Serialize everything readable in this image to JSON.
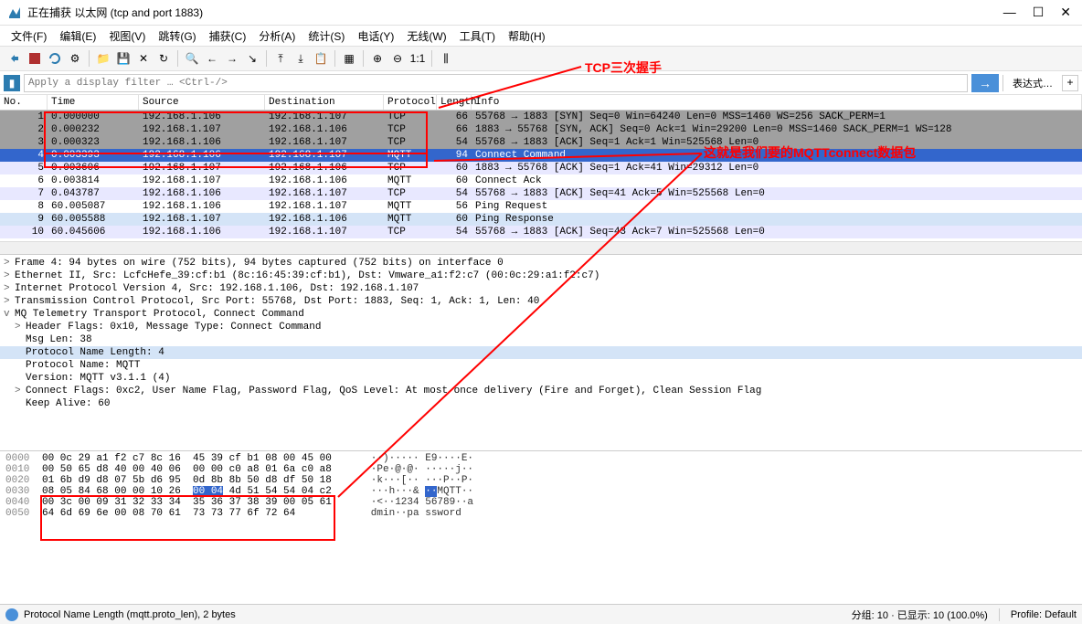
{
  "title": "正在捕获 以太网 (tcp and port 1883)",
  "menu": [
    "文件(F)",
    "编辑(E)",
    "视图(V)",
    "跳转(G)",
    "捕获(C)",
    "分析(A)",
    "统计(S)",
    "电话(Y)",
    "无线(W)",
    "工具(T)",
    "帮助(H)"
  ],
  "filter": {
    "placeholder": "Apply a display filter … <Ctrl-/>",
    "expression": "表达式…"
  },
  "columns": {
    "no": "No.",
    "time": "Time",
    "src": "Source",
    "dst": "Destination",
    "proto": "Protocol",
    "len": "Length",
    "info": "Info"
  },
  "annotations": {
    "tcp_handshake": "TCP三次握手",
    "mqtt_connect": "这就是我们要的MQTTconnect数据包"
  },
  "packets": [
    {
      "no": "1",
      "time": "0.000000",
      "src": "192.168.1.106",
      "dst": "192.168.1.107",
      "proto": "TCP",
      "len": "66",
      "info": "55768 → 1883 [SYN] Seq=0 Win=64240 Len=0 MSS=1460 WS=256 SACK_PERM=1",
      "cls": "grey"
    },
    {
      "no": "2",
      "time": "0.000232",
      "src": "192.168.1.107",
      "dst": "192.168.1.106",
      "proto": "TCP",
      "len": "66",
      "info": "1883 → 55768 [SYN, ACK] Seq=0 Ack=1 Win=29200 Len=0 MSS=1460 SACK_PERM=1 WS=128",
      "cls": "grey"
    },
    {
      "no": "3",
      "time": "0.000323",
      "src": "192.168.1.106",
      "dst": "192.168.1.107",
      "proto": "TCP",
      "len": "54",
      "info": "55768 → 1883 [ACK] Seq=1 Ack=1 Win=525568 Len=0",
      "cls": "grey"
    },
    {
      "no": "4",
      "time": "0.003393",
      "src": "192.168.1.106",
      "dst": "192.168.1.107",
      "proto": "MQTT",
      "len": "94",
      "info": "Connect Command",
      "cls": "blue-sel"
    },
    {
      "no": "5",
      "time": "0.003606",
      "src": "192.168.1.107",
      "dst": "192.168.1.106",
      "proto": "TCP",
      "len": "60",
      "info": "1883 → 55768 [ACK] Seq=1 Ack=41 Win=29312 Len=0",
      "cls": "lightblue"
    },
    {
      "no": "6",
      "time": "0.003814",
      "src": "192.168.1.107",
      "dst": "192.168.1.106",
      "proto": "MQTT",
      "len": "60",
      "info": "Connect Ack",
      "cls": "white"
    },
    {
      "no": "7",
      "time": "0.043787",
      "src": "192.168.1.106",
      "dst": "192.168.1.107",
      "proto": "TCP",
      "len": "54",
      "info": "55768 → 1883 [ACK] Seq=41 Ack=5 Win=525568 Len=0",
      "cls": "lightblue"
    },
    {
      "no": "8",
      "time": "60.005087",
      "src": "192.168.1.106",
      "dst": "192.168.1.107",
      "proto": "MQTT",
      "len": "56",
      "info": "Ping Request",
      "cls": "white"
    },
    {
      "no": "9",
      "time": "60.005588",
      "src": "192.168.1.107",
      "dst": "192.168.1.106",
      "proto": "MQTT",
      "len": "60",
      "info": "Ping Response",
      "cls": "light2"
    },
    {
      "no": "10",
      "time": "60.045606",
      "src": "192.168.1.106",
      "dst": "192.168.1.107",
      "proto": "TCP",
      "len": "54",
      "info": "55768 → 1883 [ACK] Seq=43 Ack=7 Win=525568 Len=0",
      "cls": "lightblue"
    }
  ],
  "tree": [
    {
      "caret": ">",
      "text": "Frame 4: 94 bytes on wire (752 bits), 94 bytes captured (752 bits) on interface 0",
      "indent": 0
    },
    {
      "caret": ">",
      "text": "Ethernet II, Src: LcfcHefe_39:cf:b1 (8c:16:45:39:cf:b1), Dst: Vmware_a1:f2:c7 (00:0c:29:a1:f2:c7)",
      "indent": 0
    },
    {
      "caret": ">",
      "text": "Internet Protocol Version 4, Src: 192.168.1.106, Dst: 192.168.1.107",
      "indent": 0
    },
    {
      "caret": ">",
      "text": "Transmission Control Protocol, Src Port: 55768, Dst Port: 1883, Seq: 1, Ack: 1, Len: 40",
      "indent": 0
    },
    {
      "caret": "v",
      "text": "MQ Telemetry Transport Protocol, Connect Command",
      "indent": 0
    },
    {
      "caret": ">",
      "text": "Header Flags: 0x10, Message Type: Connect Command",
      "indent": 1
    },
    {
      "caret": "",
      "text": "Msg Len: 38",
      "indent": 1
    },
    {
      "caret": "",
      "text": "Protocol Name Length: 4",
      "indent": 1,
      "cls": "hilite"
    },
    {
      "caret": "",
      "text": "Protocol Name: MQTT",
      "indent": 1
    },
    {
      "caret": "",
      "text": "Version: MQTT v3.1.1 (4)",
      "indent": 1
    },
    {
      "caret": ">",
      "text": "Connect Flags: 0xc2, User Name Flag, Password Flag, QoS Level: At most once delivery (Fire and Forget), Clean Session Flag",
      "indent": 1
    },
    {
      "caret": "",
      "text": "Keep Alive: 60",
      "indent": 1
    }
  ],
  "hex": [
    {
      "off": "0000",
      "b1": "00 0c 29 a1 f2 c7 8c 16",
      "b2": "45 39 cf b1 08 00 45 00",
      "a": "··)····· E9····E·"
    },
    {
      "off": "0010",
      "b1": "00 50 65 d8 40 00 40 06",
      "b2": "00 00 c0 a8 01 6a c0 a8",
      "a": "·Pe·@·@· ·····j··"
    },
    {
      "off": "0020",
      "b1": "01 6b d9 d8 07 5b d6 95",
      "b2": "0d 8b 8b 50 d8 df 50 18",
      "a": "·k···[·· ···P··P·"
    },
    {
      "off": "0030",
      "b1": "08 05 84 68 00 00 10 26",
      "b2_pre": "",
      "b2_sel": "00 04",
      "b2_post": " 4d 51 54 54 04 c2",
      "a_pre": "···h···& ",
      "a_sel": "··",
      "a_post": "MQTT··"
    },
    {
      "off": "0040",
      "b1": "00 3c 00 09 31 32 33 34",
      "b2": "35 36 37 38 39 00 05 61",
      "a": "·<··1234 56789··a"
    },
    {
      "off": "0050",
      "b1": "64 6d 69 6e 00 08 70 61",
      "b2": "73 73 77 6f 72 64",
      "a": "dmin··pa ssword"
    }
  ],
  "status": {
    "left": "Protocol Name Length (mqtt.proto_len), 2 bytes",
    "mid": "分组: 10 · 已显示: 10 (100.0%)",
    "right": "Profile: Default"
  }
}
